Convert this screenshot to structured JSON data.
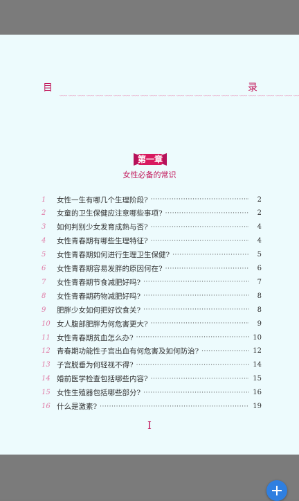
{
  "toc_heading": {
    "left": "目",
    "right": "录"
  },
  "chapter": {
    "badge": "第一章",
    "title": "女性必备的常识"
  },
  "entries": [
    {
      "num": "1",
      "text": "女性一生有哪几个生理阶段?",
      "page": "2"
    },
    {
      "num": "2",
      "text": "女童的卫生保健应注意哪些事项?",
      "page": "2"
    },
    {
      "num": "3",
      "text": "如何判别少女发育成熟与否?",
      "page": "4"
    },
    {
      "num": "4",
      "text": "女性青春期有哪些生理特征?",
      "page": "4"
    },
    {
      "num": "5",
      "text": "女性青春期如何进行生理卫生保健?",
      "page": "5"
    },
    {
      "num": "6",
      "text": "女性青春期容易发胖的原因何在?",
      "page": "6"
    },
    {
      "num": "7",
      "text": "女性青春期节食减肥好吗?",
      "page": "7"
    },
    {
      "num": "8",
      "text": "女性青春期药物减肥好吗?",
      "page": "8"
    },
    {
      "num": "9",
      "text": "肥胖少女如何把好饮食关?",
      "page": "8"
    },
    {
      "num": "10",
      "text": "女人腹部肥胖为何危害更大?",
      "page": "9"
    },
    {
      "num": "11",
      "text": "女性青春期贫血怎么办?",
      "page": "10"
    },
    {
      "num": "12",
      "text": "青春期功能性子宫出血有何危害及如何防治?",
      "page": "12"
    },
    {
      "num": "13",
      "text": "子宫脱垂为何轻视不得?",
      "page": "14"
    },
    {
      "num": "14",
      "text": "婚前医学检查包括哪些内容?",
      "page": "15"
    },
    {
      "num": "15",
      "text": "女性生殖器包括哪些部分?",
      "page": "16"
    },
    {
      "num": "16",
      "text": "什么是激素?",
      "page": "19"
    }
  ],
  "page_numeral": "I",
  "icons": {
    "fab": "plus-icon"
  },
  "colors": {
    "accent": "#c2185b",
    "page_bg": "#edfbfd",
    "fab": "#2f7fe0"
  }
}
